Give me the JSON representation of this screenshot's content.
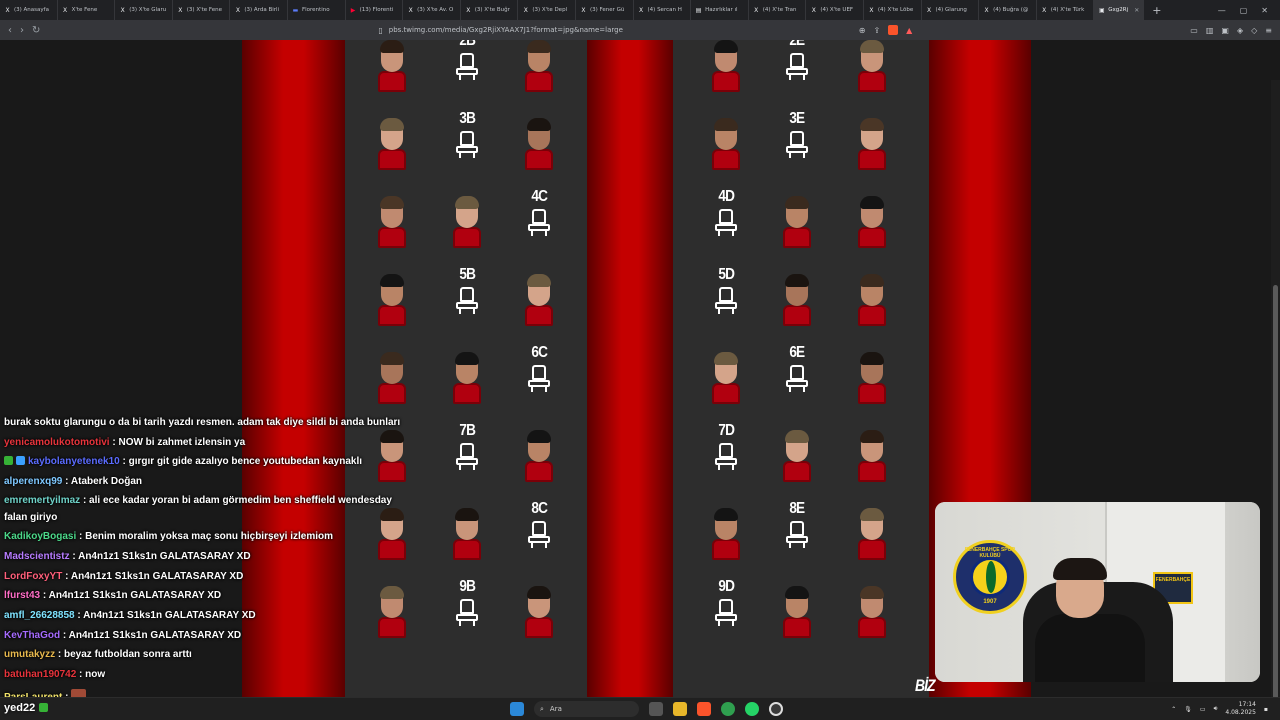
{
  "tabs": [
    {
      "icon": "x-icon",
      "label": "(3) Anasayfa"
    },
    {
      "icon": "x-icon",
      "label": "X'te Fene"
    },
    {
      "icon": "x-icon",
      "label": "(3) X'te Glaru"
    },
    {
      "icon": "x-icon",
      "label": "(3) X'te Fene"
    },
    {
      "icon": "x-icon",
      "label": "(3) Arda Birli"
    },
    {
      "icon": "flag-icon",
      "label": "Florentino"
    },
    {
      "icon": "youtube-icon",
      "label": "(13) Florenti"
    },
    {
      "icon": "x-icon",
      "label": "(3) X'te Av. O"
    },
    {
      "icon": "x-icon",
      "label": "(3) X'te Buğr"
    },
    {
      "icon": "x-icon",
      "label": "(3) X'te Depl"
    },
    {
      "icon": "x-icon",
      "label": "(3) Fener Gü"
    },
    {
      "icon": "x-icon",
      "label": "(4) Sercan H"
    },
    {
      "icon": "doc-icon",
      "label": "Hazırlıklar ıl"
    },
    {
      "icon": "x-icon",
      "label": "(4) X'te Tran"
    },
    {
      "icon": "x-icon",
      "label": "(4) X'te UEF"
    },
    {
      "icon": "x-icon",
      "label": "(4) X'te Lõbe"
    },
    {
      "icon": "x-icon",
      "label": "(4) Glarung"
    },
    {
      "icon": "x-icon",
      "label": "(4) Buğra (@"
    },
    {
      "icon": "x-icon",
      "label": "(4) X'te Türk"
    }
  ],
  "active_tab": {
    "label": "Gxg2Rj"
  },
  "address": {
    "url": "pbs.twimg.com/media/Gxg2RjiXYAAX7J1?format=jpg&name=large"
  },
  "seats": [
    {
      "code": "2B"
    },
    {
      "code": "2E"
    },
    {
      "code": "3B"
    },
    {
      "code": "3E"
    },
    {
      "code": "4C"
    },
    {
      "code": "4D"
    },
    {
      "code": "5B"
    },
    {
      "code": "5D"
    },
    {
      "code": "6C"
    },
    {
      "code": "6E"
    },
    {
      "code": "7B"
    },
    {
      "code": "7D"
    },
    {
      "code": "8C"
    },
    {
      "code": "8E"
    },
    {
      "code": "9B"
    },
    {
      "code": "9D"
    }
  ],
  "chat": [
    {
      "user": "",
      "color": "#ffffff",
      "text": "burak soktu glarungu o da bi tarih yazdı resmen. adam tak diye sildi bi anda bunları"
    },
    {
      "user": "yenicamolukotomotivi",
      "color": "#e8343c",
      "text": ": NOW bi zahmet izlensin ya"
    },
    {
      "user": "kaybolanyetenek10",
      "color": "#5b6cff",
      "text": ": gırgır git gide azalıyo bence youtubedan kaynaklı",
      "badges": true
    },
    {
      "user": "alperenxq99",
      "color": "#7fc8ff",
      "text": ": Ataberk Doğan"
    },
    {
      "user": "emremertyilmaz",
      "color": "#6fd3c9",
      "text": ": ali ece kadar yoran bi adam görmedim ben sheffield wendesday"
    },
    {
      "user": "",
      "color": "#ffffff",
      "text": "falan giriyo"
    },
    {
      "user": "KadikoyBogasi",
      "color": "#4cd98a",
      "text": ": Benim moralim yoksa maç sonu hiçbirşeyi izlemiom"
    },
    {
      "user": "Madscientistz",
      "color": "#b77cff",
      "text": ": An4n1z1 S1ks1n GALATASARAY XD"
    },
    {
      "user": "LordFoxyYT",
      "color": "#ff5f7a",
      "text": ": An4n1z1 S1ks1n GALATASARAY XD"
    },
    {
      "user": "lfurst43",
      "color": "#ff6ec7",
      "text": ": An4n1z1 S1ks1n GALATASARAY XD"
    },
    {
      "user": "amfl_26628858",
      "color": "#7fe3ff",
      "text": ": An4n1z1 S1ks1n GALATASARAY XD"
    },
    {
      "user": "KevThaGod",
      "color": "#a66bff",
      "text": ": An4n1z1 S1ks1n GALATASARAY XD"
    },
    {
      "user": "umutakyzz",
      "color": "#e8b94d",
      "text": ": beyaz futboldan sonra arttı"
    },
    {
      "user": "batuhan190742",
      "color": "#e8343c",
      "text": ": now"
    },
    {
      "user": "ParsLaurent",
      "color": "#f2e36b",
      "text": ":",
      "emote": true
    }
  ],
  "streamer": {
    "name": "yed22"
  },
  "cam": {
    "crest_text": "FENERBAHÇE SPOR KULÜBÜ",
    "crest_year": "1907",
    "flag_text": "FENERBAHÇE"
  },
  "brand": {
    "text": "BİZ"
  },
  "taskbar": {
    "search_placeholder": "Ara",
    "time": "17:14",
    "date": "4.08.2025"
  }
}
